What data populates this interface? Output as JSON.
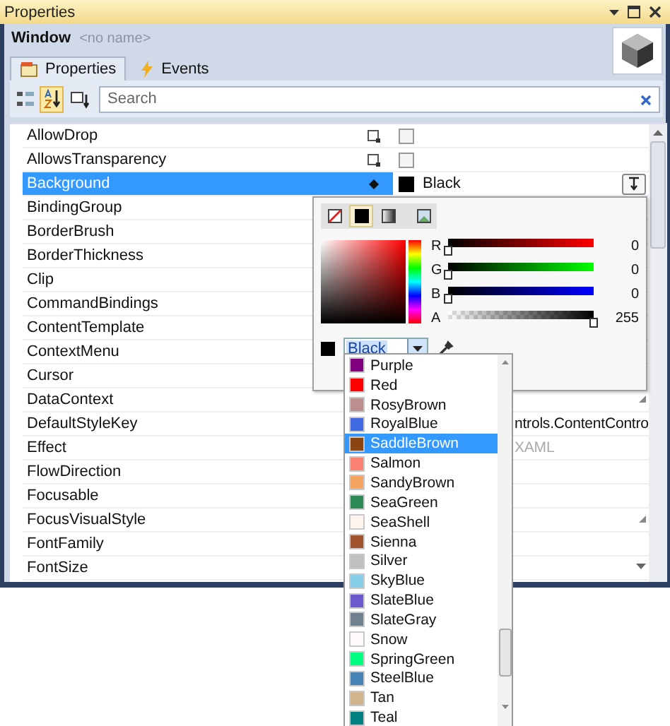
{
  "window": {
    "title": "Properties"
  },
  "object": {
    "type": "Window",
    "name": "<no name>"
  },
  "tabs": [
    {
      "label": "Properties",
      "selected": true
    },
    {
      "label": "Events",
      "selected": false
    }
  ],
  "toolbar": [
    {
      "kind": "categorized",
      "selected": false
    },
    {
      "kind": "alphabetical",
      "selected": true
    },
    {
      "kind": "filter",
      "selected": false
    }
  ],
  "search": {
    "placeholder": "Search"
  },
  "properties": [
    {
      "name": "AllowDrop",
      "kind": "checkbox",
      "local": false,
      "checked": false,
      "selected": false
    },
    {
      "name": "AllowsTransparency",
      "kind": "checkbox",
      "local": false,
      "checked": false,
      "selected": false
    },
    {
      "name": "Background",
      "kind": "brush",
      "local": true,
      "value": "Black",
      "color": "#000000",
      "selected": true
    },
    {
      "name": "BindingGroup",
      "kind": "empty",
      "selected": false
    },
    {
      "name": "BorderBrush",
      "kind": "empty",
      "selected": false
    },
    {
      "name": "BorderThickness",
      "kind": "empty",
      "selected": false
    },
    {
      "name": "Clip",
      "kind": "empty",
      "selected": false
    },
    {
      "name": "CommandBindings",
      "kind": "empty",
      "selected": false
    },
    {
      "name": "ContentTemplate",
      "kind": "empty",
      "selected": false
    },
    {
      "name": "ContextMenu",
      "kind": "empty",
      "selected": false
    },
    {
      "name": "Cursor",
      "kind": "empty",
      "selected": false
    },
    {
      "name": "DataContext",
      "kind": "empty",
      "grip": true,
      "selected": false
    },
    {
      "name": "DefaultStyleKey",
      "kind": "text",
      "value": "ntrols.ContentContro",
      "selected": false
    },
    {
      "name": "Effect",
      "kind": "text",
      "value": "XAML",
      "muted": true,
      "selected": false
    },
    {
      "name": "FlowDirection",
      "kind": "empty",
      "selected": false
    },
    {
      "name": "Focusable",
      "kind": "empty",
      "selected": false
    },
    {
      "name": "FocusVisualStyle",
      "kind": "empty",
      "grip": true,
      "selected": false
    },
    {
      "name": "FontFamily",
      "kind": "empty",
      "selected": false
    },
    {
      "name": "FontSize",
      "kind": "empty",
      "dropdown": true,
      "selected": false
    }
  ],
  "color_editor": {
    "brush_types": [
      {
        "kind": "none",
        "selected": false
      },
      {
        "kind": "solid",
        "selected": true
      },
      {
        "kind": "gradient",
        "selected": false
      },
      {
        "kind": "image",
        "selected": false
      }
    ],
    "channels": [
      {
        "label": "R",
        "level": 0,
        "reading": "0"
      },
      {
        "label": "G",
        "level": 0,
        "reading": "0"
      },
      {
        "label": "B",
        "level": 0,
        "reading": "0"
      },
      {
        "label": "A",
        "level": 1,
        "reading": "255"
      }
    ],
    "color": "#000000",
    "color_name": "Black",
    "colors": [
      {
        "name": "Purple",
        "color": "#800080",
        "selected": false
      },
      {
        "name": "Red",
        "color": "#ff0000",
        "selected": false
      },
      {
        "name": "RosyBrown",
        "color": "#bc8f8f",
        "selected": false
      },
      {
        "name": "RoyalBlue",
        "color": "#4169e1",
        "selected": false
      },
      {
        "name": "SaddleBrown",
        "color": "#8b4513",
        "selected": true
      },
      {
        "name": "Salmon",
        "color": "#fa8072",
        "selected": false
      },
      {
        "name": "SandyBrown",
        "color": "#f4a460",
        "selected": false
      },
      {
        "name": "SeaGreen",
        "color": "#2e8b57",
        "selected": false
      },
      {
        "name": "SeaShell",
        "color": "#fff5ee",
        "selected": false
      },
      {
        "name": "Sienna",
        "color": "#a0522d",
        "selected": false
      },
      {
        "name": "Silver",
        "color": "#c0c0c0",
        "selected": false
      },
      {
        "name": "SkyBlue",
        "color": "#87ceeb",
        "selected": false
      },
      {
        "name": "SlateBlue",
        "color": "#6a5acd",
        "selected": false
      },
      {
        "name": "SlateGray",
        "color": "#708090",
        "selected": false
      },
      {
        "name": "Snow",
        "color": "#fffafa",
        "selected": false
      },
      {
        "name": "SpringGreen",
        "color": "#00ff7f",
        "selected": false
      },
      {
        "name": "SteelBlue",
        "color": "#4682b4",
        "selected": false
      },
      {
        "name": "Tan",
        "color": "#d2b48c",
        "selected": false
      },
      {
        "name": "Teal",
        "color": "#008080",
        "selected": false
      }
    ]
  }
}
